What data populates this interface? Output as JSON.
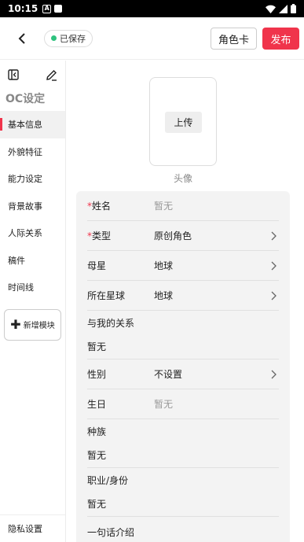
{
  "status_bar": {
    "time": "10:15",
    "a_icon": "A"
  },
  "header": {
    "saved_label": "已保存",
    "character_card_label": "角色卡",
    "publish_label": "发布",
    "colors": {
      "accent": "#f0344b",
      "saved_dot": "#2ec27e"
    }
  },
  "sidebar": {
    "title": "OC设定",
    "items": [
      {
        "label": "基本信息",
        "active": true
      },
      {
        "label": "外貌特征"
      },
      {
        "label": "能力设定"
      },
      {
        "label": "背景故事"
      },
      {
        "label": "人际关系"
      },
      {
        "label": "稿件"
      },
      {
        "label": "时间线"
      }
    ],
    "add_module_label": "新增模块",
    "privacy_label": "隐私设置"
  },
  "avatar": {
    "upload_label": "上传",
    "caption": "头像"
  },
  "form": {
    "name": {
      "label": "姓名",
      "required": "*",
      "value": "暂无"
    },
    "type": {
      "label": "类型",
      "required": "*",
      "value": "原创角色"
    },
    "home_star": {
      "label": "母星",
      "value": "地球"
    },
    "current_star": {
      "label": "所在星球",
      "value": "地球"
    },
    "relation": {
      "label": "与我的关系",
      "value": "暂无"
    },
    "gender": {
      "label": "性别",
      "value": "不设置"
    },
    "birthday": {
      "label": "生日",
      "value": "暂无"
    },
    "race": {
      "label": "种族",
      "value": "暂无"
    },
    "occupation": {
      "label": "职业/身份",
      "value": "暂无"
    },
    "intro": {
      "label": "一句话介绍"
    }
  }
}
